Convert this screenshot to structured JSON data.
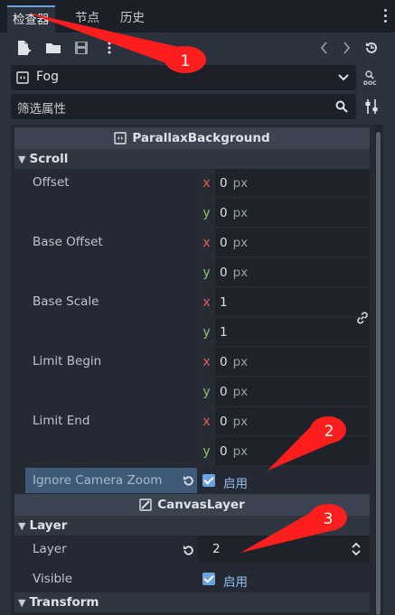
{
  "tabs": [
    {
      "label": "检查器",
      "active": true
    },
    {
      "label": "节点",
      "active": false
    },
    {
      "label": "历史",
      "active": false
    }
  ],
  "toolbar": {
    "icons": [
      "new-resource-icon",
      "open-folder-icon",
      "save-icon",
      "more-icon",
      "history-back-icon",
      "history-forward-icon",
      "object-history-icon"
    ]
  },
  "object": {
    "name": "Fog"
  },
  "filter": {
    "placeholder": "筛选属性"
  },
  "classes": [
    {
      "name": "ParallaxBackground"
    },
    {
      "name": "CanvasLayer"
    }
  ],
  "sections": {
    "scroll": "Scroll",
    "layer": "Layer",
    "transform": "Transform"
  },
  "props": {
    "offset": {
      "label": "Offset",
      "x": "0",
      "y": "0",
      "unit": "px"
    },
    "base_offset": {
      "label": "Base Offset",
      "x": "0",
      "y": "0",
      "unit": "px"
    },
    "base_scale": {
      "label": "Base Scale",
      "x": "1",
      "y": "1"
    },
    "limit_begin": {
      "label": "Limit Begin",
      "x": "0",
      "y": "0",
      "unit": "px"
    },
    "limit_end": {
      "label": "Limit End",
      "x": "0",
      "y": "0",
      "unit": "px"
    },
    "ignore_camera_zoom": {
      "label": "Ignore Camera Zoom",
      "checked": true,
      "value_label": "启用"
    },
    "layer": {
      "label": "Layer",
      "value": "2"
    },
    "visible": {
      "label": "Visible",
      "checked": true,
      "value_label": "启用"
    }
  },
  "axis_labels": {
    "x": "x",
    "y": "y"
  },
  "annotations": [
    "1",
    "2",
    "3"
  ],
  "colors": {
    "accent": "#6ea2dc",
    "annotation_red": "#ff1e1e",
    "axis_x": "#e35d4f",
    "axis_y": "#80c76e",
    "highlight_row": "#3e5a78"
  }
}
